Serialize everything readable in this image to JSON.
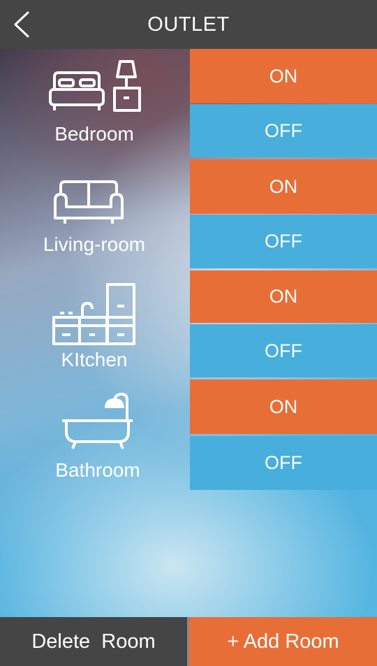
{
  "header": {
    "title": "OUTLET"
  },
  "rooms": [
    {
      "label": "Bedroom",
      "on_label": "ON",
      "off_label": "OFF"
    },
    {
      "label": "Living-room",
      "on_label": "ON",
      "off_label": "OFF"
    },
    {
      "label": "KItchen",
      "on_label": "ON",
      "off_label": "OFF"
    },
    {
      "label": "Bathroom",
      "on_label": "ON",
      "off_label": "OFF"
    }
  ],
  "footer": {
    "delete_label": "Delete  Room",
    "add_label": "+ Add Room"
  },
  "icons": [
    "back-icon",
    "bed-icon",
    "lamp-icon",
    "sofa-icon",
    "kitchen-icon",
    "bathtub-icon"
  ],
  "colors": {
    "header": "#454545",
    "on": "#e76f37",
    "off": "#48aedc"
  }
}
